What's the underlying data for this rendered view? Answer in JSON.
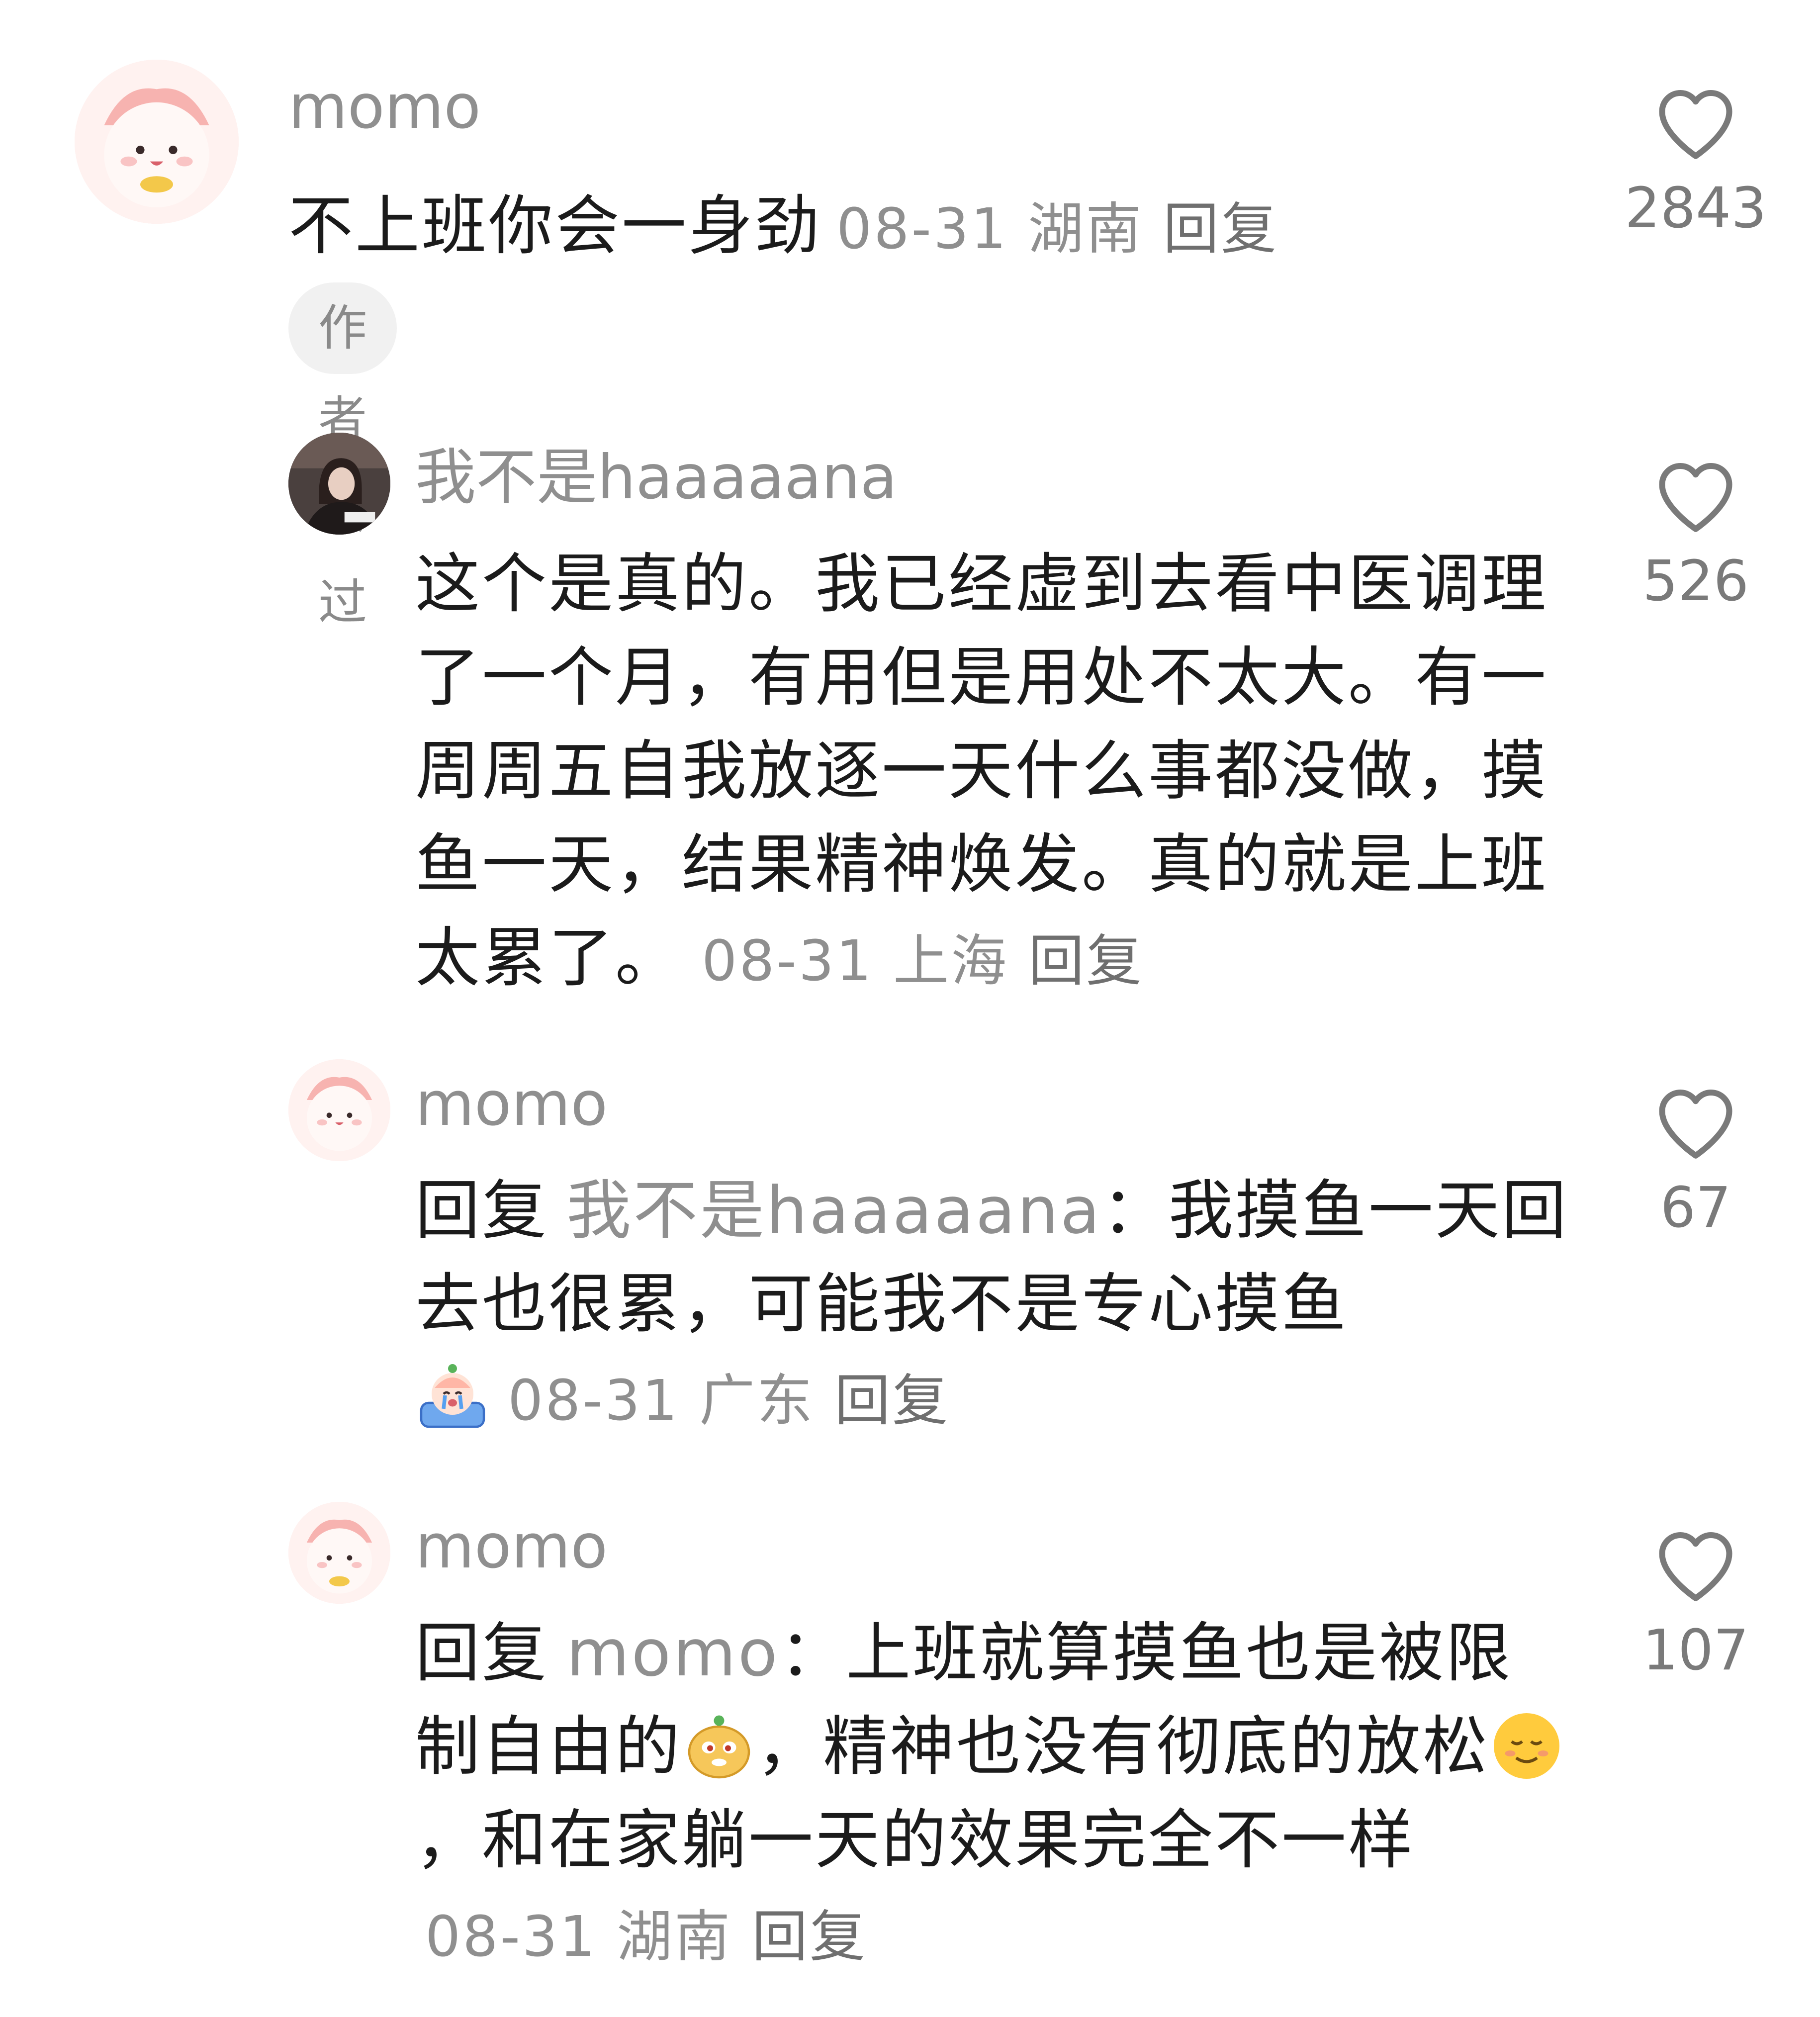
{
  "comments": [
    {
      "username": "momo",
      "text": "不上班你会一身劲",
      "date": "08-31",
      "location": "湖南",
      "reply_label": "回复",
      "badge": "作者赞过",
      "likes": "2843"
    },
    {
      "username": "我不是haaaaana",
      "text": "这个是真的。我已经虚到去看中医调理了一个月，有用但是用处不太大。有一周周五自我放逐一天什么事都没做，摸鱼一天，结果精神焕发。真的就是上班太累了。",
      "date": "08-31",
      "location": "上海",
      "reply_label": "回复",
      "likes": "526"
    },
    {
      "username": "momo",
      "reply_prefix": "回复",
      "reply_target": "我不是haaaaana",
      "text": "我摸鱼一天回去也很累，可能我不是专心摸鱼",
      "emoji": "crying-sticker",
      "date": "08-31",
      "location": "广东",
      "reply_label": "回复",
      "likes": "67"
    },
    {
      "username": "momo",
      "reply_prefix": "回复",
      "reply_target": "momo",
      "text_part1": "上班就算摸鱼也是被限制自由的",
      "emoji1": "smug-sticker",
      "text_part2": "，精神也没有彻底的放松",
      "emoji2": "relieved-face",
      "text_part3": "，和在家躺一天的效果完全不一样",
      "date": "08-31",
      "location": "湖南",
      "reply_label": "回复",
      "likes": "107"
    }
  ],
  "icons": {
    "like": "heart-outline-icon"
  },
  "colors": {
    "text": "#1b1b1b",
    "muted": "#8f8f8f",
    "badge_bg": "#f1f1f1"
  }
}
